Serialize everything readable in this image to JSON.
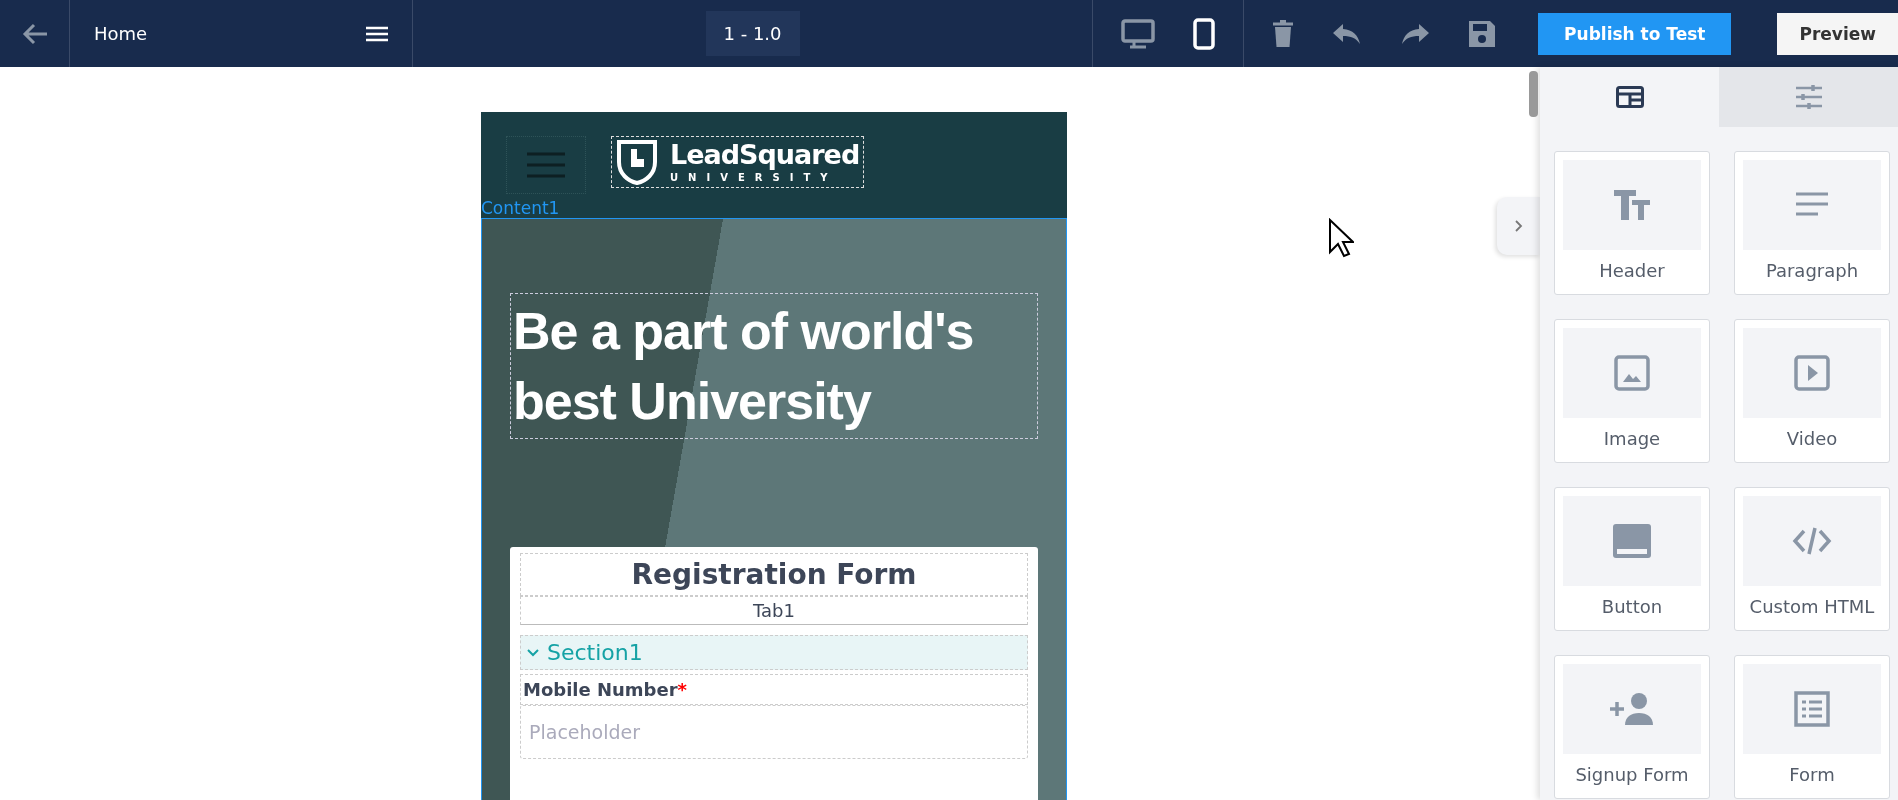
{
  "topbar": {
    "page_title": "Home",
    "version": "1 - 1.0",
    "devices": [
      {
        "kind": "desktop",
        "selected": false
      },
      {
        "kind": "mobile",
        "selected": true
      }
    ],
    "publish_button": "Publish to Test",
    "preview_button": "Preview"
  },
  "canvas": {
    "logo": {
      "name": "LeadSquared",
      "subtitle": "UNIVERSITY"
    },
    "section_label": "Content1",
    "hero_heading": "Be a part of world's best University",
    "form": {
      "title": "Registration Form",
      "tab": "Tab1",
      "section": {
        "title": "Section1",
        "expanded": true
      },
      "fields": [
        {
          "label": "Mobile Number",
          "required": true,
          "required_mark": "*",
          "placeholder": "Placeholder"
        }
      ]
    }
  },
  "panel": {
    "tabs": [
      {
        "kind": "blocks",
        "selected": true
      },
      {
        "kind": "settings",
        "selected": false
      }
    ],
    "components": [
      {
        "kind": "header",
        "label": "Header"
      },
      {
        "kind": "paragraph",
        "label": "Paragraph"
      },
      {
        "kind": "image",
        "label": "Image"
      },
      {
        "kind": "video",
        "label": "Video"
      },
      {
        "kind": "button",
        "label": "Button"
      },
      {
        "kind": "html",
        "label": "Custom HTML"
      },
      {
        "kind": "signup",
        "label": "Signup Form"
      },
      {
        "kind": "form",
        "label": "Form"
      }
    ]
  }
}
